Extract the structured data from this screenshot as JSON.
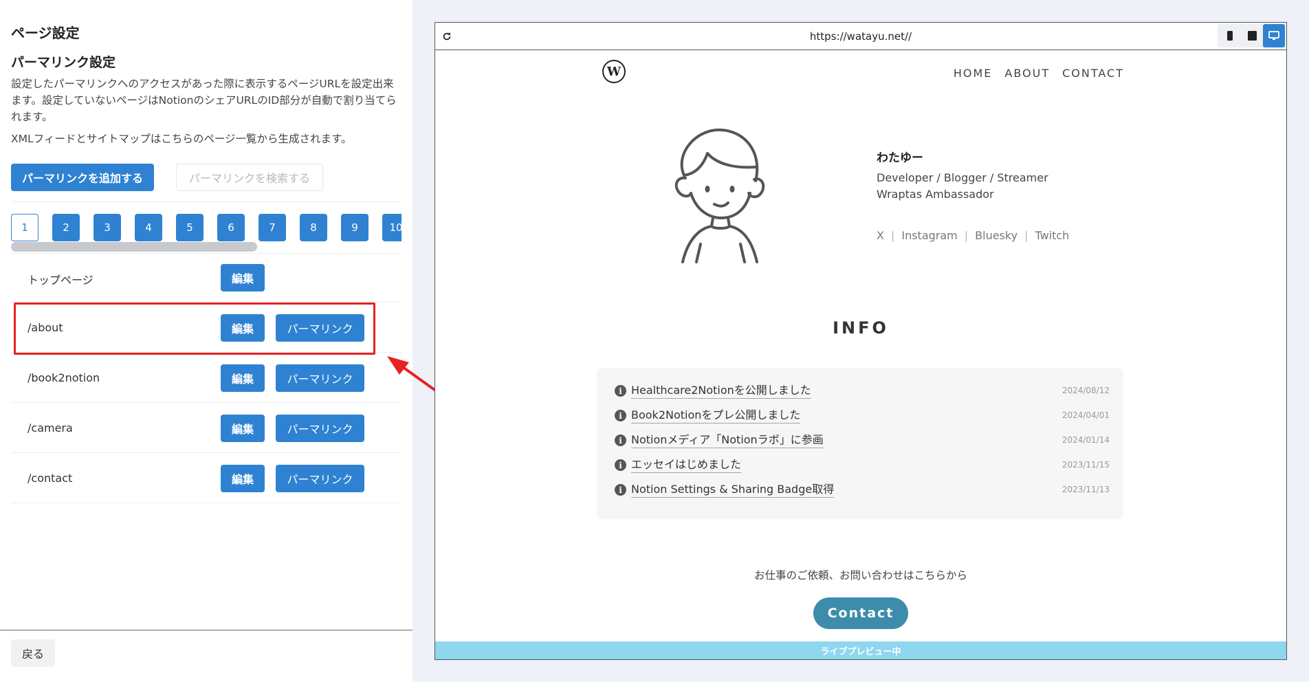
{
  "left": {
    "title": "ページ設定",
    "section_title": "パーマリンク設定",
    "description": "設定したパーマリンクへのアクセスがあった際に表示するページURLを設定出来ます。設定していないページはNotionのシェアURLのID部分が自動で割り当てられます。",
    "description2": "XMLフィードとサイトマップはこちらのページ一覧から生成されます。",
    "add_button": "パーマリンクを追加する",
    "search_placeholder": "パーマリンクを検索する",
    "pages": [
      "1",
      "2",
      "3",
      "4",
      "5",
      "6",
      "7",
      "8",
      "9",
      "10"
    ],
    "active_page": "1",
    "rows": [
      {
        "label": "トップページ",
        "edit": "編集",
        "permalink": ""
      },
      {
        "label": "/about",
        "edit": "編集",
        "permalink": "パーマリンク"
      },
      {
        "label": "/book2notion",
        "edit": "編集",
        "permalink": "パーマリンク"
      },
      {
        "label": "/camera",
        "edit": "編集",
        "permalink": "パーマリンク"
      },
      {
        "label": "/contact",
        "edit": "編集",
        "permalink": "パーマリンク"
      }
    ],
    "back_button": "戻る"
  },
  "preview": {
    "url": "https://watayu.net//",
    "refresh_icon": "refresh-icon",
    "devices": [
      "mobile-icon",
      "tablet-icon",
      "desktop-icon"
    ],
    "active_device": "desktop-icon",
    "site": {
      "logo": "W",
      "nav": [
        "HOME",
        "ABOUT",
        "CONTACT"
      ],
      "name": "わたゆー",
      "role1": "Developer / Blogger / Streamer",
      "role2": "Wraptas Ambassador",
      "social": [
        "X",
        "Instagram",
        "Bluesky",
        "Twitch"
      ],
      "info_title": "INFO",
      "info": [
        {
          "title": "Healthcare2Notionを公開しました",
          "date": "2024/08/12"
        },
        {
          "title": "Book2Notionをプレ公開しました",
          "date": "2024/04/01"
        },
        {
          "title": "Notionメディア「Notionラボ」に参画",
          "date": "2024/01/14"
        },
        {
          "title": "エッセイはじめました",
          "date": "2023/11/15"
        },
        {
          "title": "Notion Settings & Sharing Badge取得",
          "date": "2023/11/13"
        }
      ],
      "contact_text": "お仕事のご依頼、お問い合わせはこちらから",
      "contact_button": "Contact"
    },
    "live_label": "ライブプレビュー中"
  },
  "colors": {
    "primary": "#2f82d2",
    "highlight": "#e52222",
    "contact_button": "#3e8cab",
    "live_bar": "#8fd6ef"
  }
}
